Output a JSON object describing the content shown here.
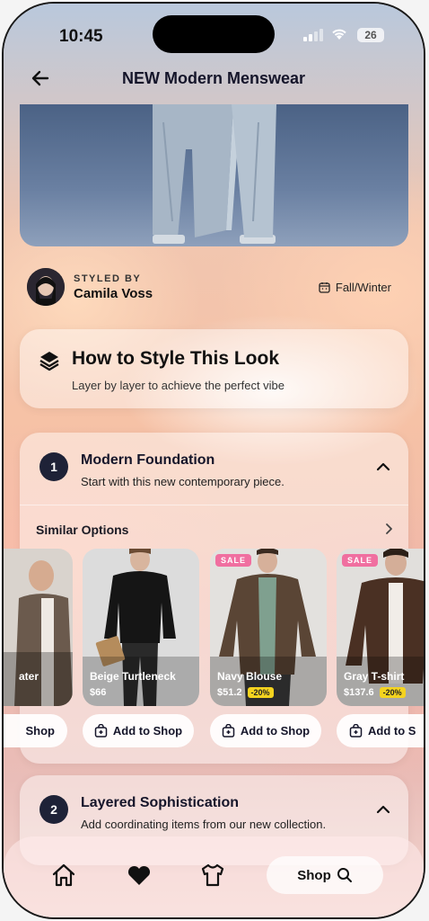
{
  "status_bar": {
    "time": "10:45",
    "battery": "26"
  },
  "header": {
    "title": "NEW Modern Menswear",
    "back_icon": "arrow-left-icon"
  },
  "stylist": {
    "label": "STYLED BY",
    "name": "Camila Voss",
    "season": "Fall/Winter"
  },
  "style_card": {
    "title": "How to Style This Look",
    "subtitle": "Layer by layer to achieve the perfect vibe"
  },
  "steps": [
    {
      "number": "1",
      "title": "Modern Foundation",
      "subtitle": "Start with this new contemporary piece.",
      "similar_label": "Similar Options",
      "products": [
        {
          "name": "ater",
          "price": "",
          "discount": "",
          "sale": false
        },
        {
          "name": "Beige Turtleneck",
          "price": "$66",
          "discount": "",
          "sale": false
        },
        {
          "name": "Navy Blouse",
          "price": "$51.2",
          "discount": "-20%",
          "sale": true
        },
        {
          "name": "Gray T-shirt",
          "price": "$137.6",
          "discount": "-20%",
          "sale": true
        }
      ],
      "add_labels": [
        "Shop",
        "Add to Shop",
        "Add to Shop",
        "Add to S"
      ],
      "sale_label": "SALE"
    },
    {
      "number": "2",
      "title": "Layered Sophistication",
      "subtitle": "Add coordinating items from our new collection."
    }
  ],
  "tabbar": {
    "shop_label": "Shop"
  },
  "colors": {
    "accent_dark": "#1e2237",
    "sale_pink": "#f06fa0",
    "discount_yellow": "#f4d31f"
  }
}
